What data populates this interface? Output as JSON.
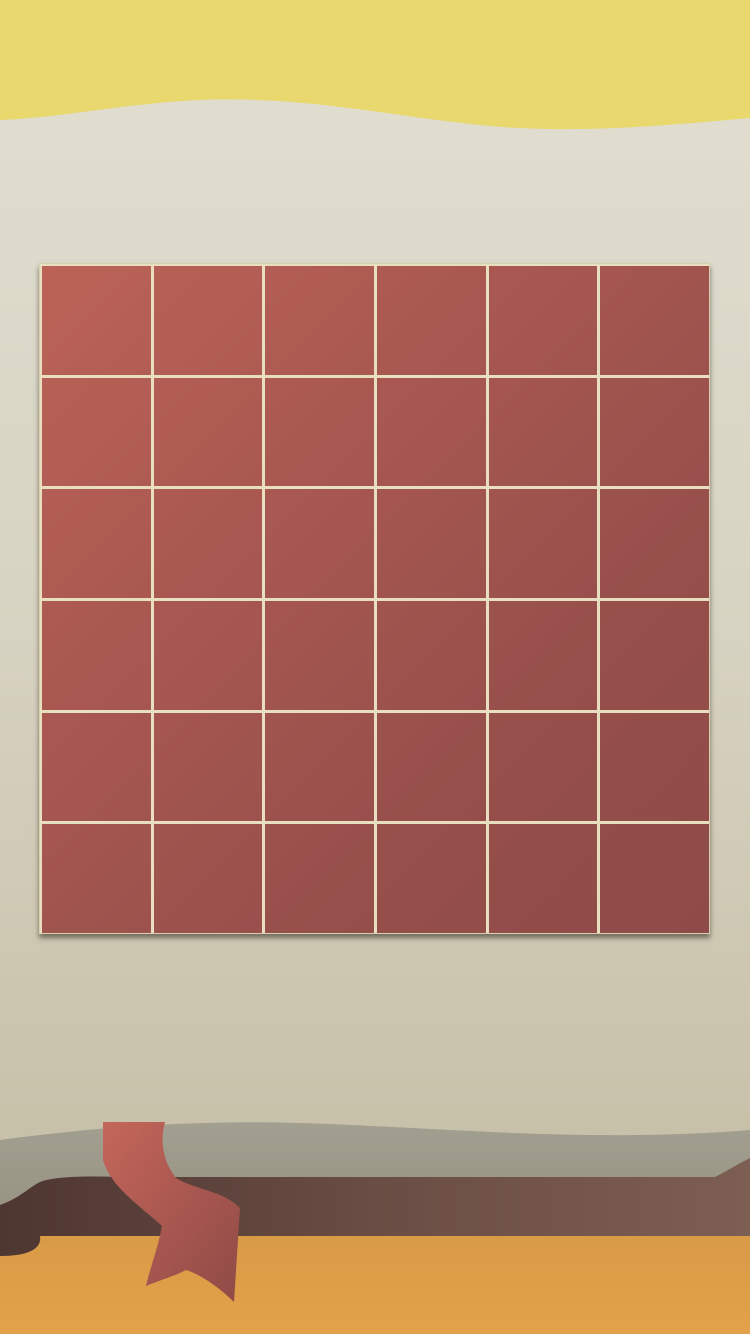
{
  "game": {
    "board": {
      "rows": 6,
      "columns": 6,
      "tile_color": "#a85850",
      "grid_line_color": "#e8dfc0"
    },
    "tiles": [
      {
        "row": 1,
        "col": 1
      },
      {
        "row": 1,
        "col": 2
      },
      {
        "row": 1,
        "col": 3
      },
      {
        "row": 1,
        "col": 4
      },
      {
        "row": 1,
        "col": 5
      },
      {
        "row": 1,
        "col": 6
      },
      {
        "row": 2,
        "col": 1
      },
      {
        "row": 2,
        "col": 2
      },
      {
        "row": 2,
        "col": 3
      },
      {
        "row": 2,
        "col": 4
      },
      {
        "row": 2,
        "col": 5
      },
      {
        "row": 2,
        "col": 6
      },
      {
        "row": 3,
        "col": 1
      },
      {
        "row": 3,
        "col": 2
      },
      {
        "row": 3,
        "col": 3
      },
      {
        "row": 3,
        "col": 4
      },
      {
        "row": 3,
        "col": 5
      },
      {
        "row": 3,
        "col": 6
      },
      {
        "row": 4,
        "col": 1
      },
      {
        "row": 4,
        "col": 2
      },
      {
        "row": 4,
        "col": 3
      },
      {
        "row": 4,
        "col": 4
      },
      {
        "row": 4,
        "col": 5
      },
      {
        "row": 4,
        "col": 6
      },
      {
        "row": 5,
        "col": 1
      },
      {
        "row": 5,
        "col": 2
      },
      {
        "row": 5,
        "col": 3
      },
      {
        "row": 5,
        "col": 4
      },
      {
        "row": 5,
        "col": 5
      },
      {
        "row": 5,
        "col": 6
      },
      {
        "row": 6,
        "col": 1
      },
      {
        "row": 6,
        "col": 2
      },
      {
        "row": 6,
        "col": 3
      },
      {
        "row": 6,
        "col": 4
      },
      {
        "row": 6,
        "col": 5
      },
      {
        "row": 6,
        "col": 6
      }
    ]
  },
  "scene": {
    "sky_color": "#e8d86e",
    "wall_color": "#dcd8c8",
    "floor_color": "#dd9e48",
    "sofa_color": "#6b4d44",
    "ribbon_color": "#b05c52"
  }
}
